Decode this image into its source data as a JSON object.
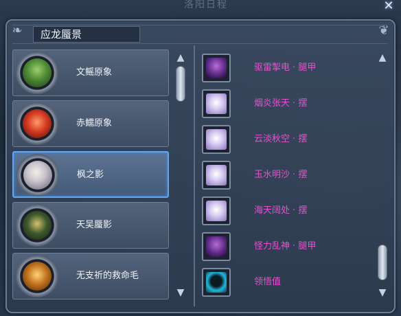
{
  "window": {
    "top_title": "洛阳日程",
    "title": "应龙蜃景",
    "close_symbol": "✕"
  },
  "bosses": [
    {
      "name": "文鳐原象",
      "portrait": "green-ogre-portrait"
    },
    {
      "name": "赤鱬原象",
      "portrait": "red-demon-portrait"
    },
    {
      "name": "枫之影",
      "portrait": "white-hair-swordsman-portrait",
      "selected": true
    },
    {
      "name": "天吴蜃影",
      "portrait": "dark-beast-portrait"
    },
    {
      "name": "无支祈的救命毛",
      "portrait": "golden-monkey-portrait"
    }
  ],
  "drops": [
    {
      "name": "驱雷掣电 · 腿甲",
      "icon": "purple-armor-icon"
    },
    {
      "name": "烟炎张天 · 摆",
      "icon": "white-robe-icon"
    },
    {
      "name": "云淡秋空 · 摆",
      "icon": "white-robe-icon"
    },
    {
      "name": "玉水明沙 · 摆",
      "icon": "white-robe-icon"
    },
    {
      "name": "海天阔处 · 摆",
      "icon": "white-robe-icon"
    },
    {
      "name": "怪力乱神 · 腿甲",
      "icon": "purple-armor-icon"
    },
    {
      "name": "领悟值",
      "icon": "cyan-silhouette-icon"
    }
  ],
  "colors": {
    "drop_text": "#e552cf",
    "selected_border": "#64a6ee"
  }
}
